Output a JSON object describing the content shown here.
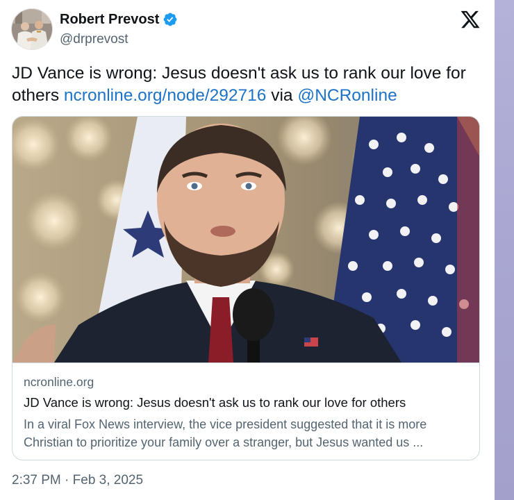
{
  "author": {
    "name": "Robert Prevost",
    "handle": "@drprevost",
    "verified": true
  },
  "tweet": {
    "text_before": "JD Vance is wrong: Jesus doesn't ask us to rank our love for others ",
    "url": "ncronline.org/node/292716",
    "via": " via ",
    "mention": "@NCRonline"
  },
  "link_card": {
    "domain": "ncronline.org",
    "title": "JD Vance is wrong: Jesus doesn't ask us to rank our love for others",
    "description": "In a viral Fox News interview, the vice president suggested that it is more Christian to prioritize your family over a stranger, but Jesus wanted us ..."
  },
  "timestamp": "2:37 PM · Feb 3, 2025",
  "icons": {
    "platform": "x-logo-icon",
    "verified": "verified-badge-icon"
  },
  "colors": {
    "link": "#1d73c8",
    "verified": "#1d9bf0",
    "secondary_text": "#536471",
    "side_strip": "#aaa8d3"
  }
}
